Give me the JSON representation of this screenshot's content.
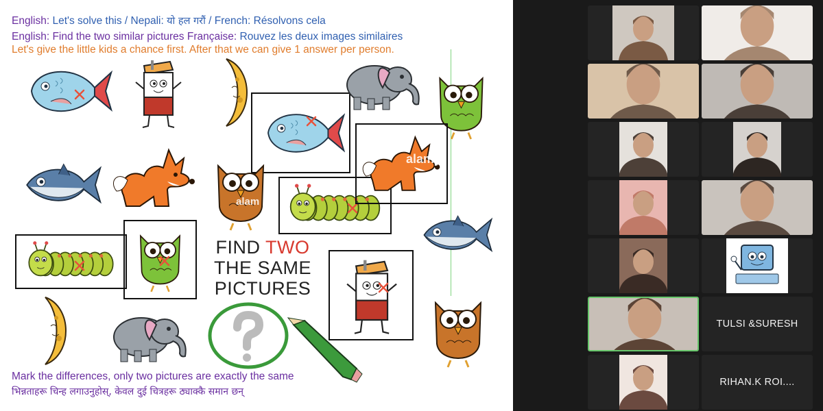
{
  "slide": {
    "line1": {
      "a": "English: ",
      "b": "Let's solve this / Nepali: ",
      "c": "यो हल गरौं",
      "d": " / French: ",
      "e": "Résolvons cela"
    },
    "line2": {
      "a": "English: ",
      "b": "Find the two similar pictures  Française: ",
      "c": "Rouvez les deux images similaires"
    },
    "line3": "Let's give the little kids a chance first. After that we can give 1 answer per person.",
    "puzzle_title": {
      "part1": "FIND ",
      "part2": "TWO",
      "line2": "THE SAME",
      "line3": "PICTURES"
    },
    "watermarks": [
      "alamy",
      "alam"
    ],
    "bottom_line1": "Mark the differences, only two pictures are exactly the same",
    "bottom_line2": "भिन्नताहरू चिन्ह लगाउनुहोस्, केवल दुई चित्रहरू ठ्याक्कै समान छन्",
    "colors": {
      "purple": "#6a2fa0",
      "blue": "#2f5fb0",
      "orange": "#e07c2c",
      "red": "#d83a2f",
      "active_speaker": "#67c76b"
    },
    "pictures": [
      {
        "name": "fish-picture",
        "icon": "fish",
        "marked": true,
        "boxed": false
      },
      {
        "name": "juice-box-picture",
        "icon": "juice-box",
        "marked": false,
        "boxed": false
      },
      {
        "name": "moon-picture",
        "icon": "moon",
        "marked": false,
        "boxed": false
      },
      {
        "name": "fish-picture",
        "icon": "fish",
        "marked": true,
        "boxed": true
      },
      {
        "name": "elephant-picture",
        "icon": "elephant",
        "marked": false,
        "boxed": false
      },
      {
        "name": "owl-picture",
        "icon": "owl",
        "marked": false,
        "boxed": false
      },
      {
        "name": "tuna-picture",
        "icon": "tuna",
        "marked": false,
        "boxed": false
      },
      {
        "name": "fox-picture",
        "icon": "fox",
        "marked": false,
        "boxed": false
      },
      {
        "name": "owl-picture",
        "icon": "owl",
        "marked": false,
        "boxed": false
      },
      {
        "name": "caterpillar-picture",
        "icon": "caterpillar",
        "marked": true,
        "boxed": true
      },
      {
        "name": "fox-picture",
        "icon": "fox",
        "marked": false,
        "boxed": true
      },
      {
        "name": "caterpillar-picture",
        "icon": "caterpillar",
        "marked": true,
        "boxed": true
      },
      {
        "name": "owl-picture",
        "icon": "owl",
        "marked": true,
        "boxed": true
      },
      {
        "name": "tuna-picture",
        "icon": "tuna",
        "marked": false,
        "boxed": false
      },
      {
        "name": "moon-picture",
        "icon": "moon",
        "marked": false,
        "boxed": false
      },
      {
        "name": "elephant-picture",
        "icon": "elephant",
        "marked": false,
        "boxed": false
      },
      {
        "name": "question-mark-picture",
        "icon": "question-mark",
        "marked": false,
        "boxed": false
      },
      {
        "name": "pencil-picture",
        "icon": "pencil",
        "marked": false,
        "boxed": false
      },
      {
        "name": "juice-box-picture",
        "icon": "juice-box",
        "marked": true,
        "boxed": true
      },
      {
        "name": "owl-picture",
        "icon": "owl",
        "marked": false,
        "boxed": false
      }
    ]
  },
  "participants": {
    "tiles": [
      {
        "kind": "video",
        "icon": "person-video"
      },
      {
        "kind": "video",
        "icon": "person-video"
      },
      {
        "kind": "video",
        "icon": "person-video"
      },
      {
        "kind": "video",
        "icon": "person-video"
      },
      {
        "kind": "video",
        "icon": "person-video"
      },
      {
        "kind": "video",
        "icon": "person-video"
      },
      {
        "kind": "video",
        "icon": "person-video"
      },
      {
        "kind": "video",
        "icon": "person-video"
      },
      {
        "kind": "video",
        "icon": "person-video"
      },
      {
        "kind": "avatar",
        "icon": "computer-cartoon-avatar"
      },
      {
        "kind": "video",
        "icon": "person-video",
        "active_speaker": true
      },
      {
        "kind": "name",
        "label": "TULSI &SURESH"
      },
      {
        "kind": "video",
        "icon": "person-video"
      },
      {
        "kind": "name",
        "label": "RIHAN.K  ROI...."
      }
    ]
  }
}
